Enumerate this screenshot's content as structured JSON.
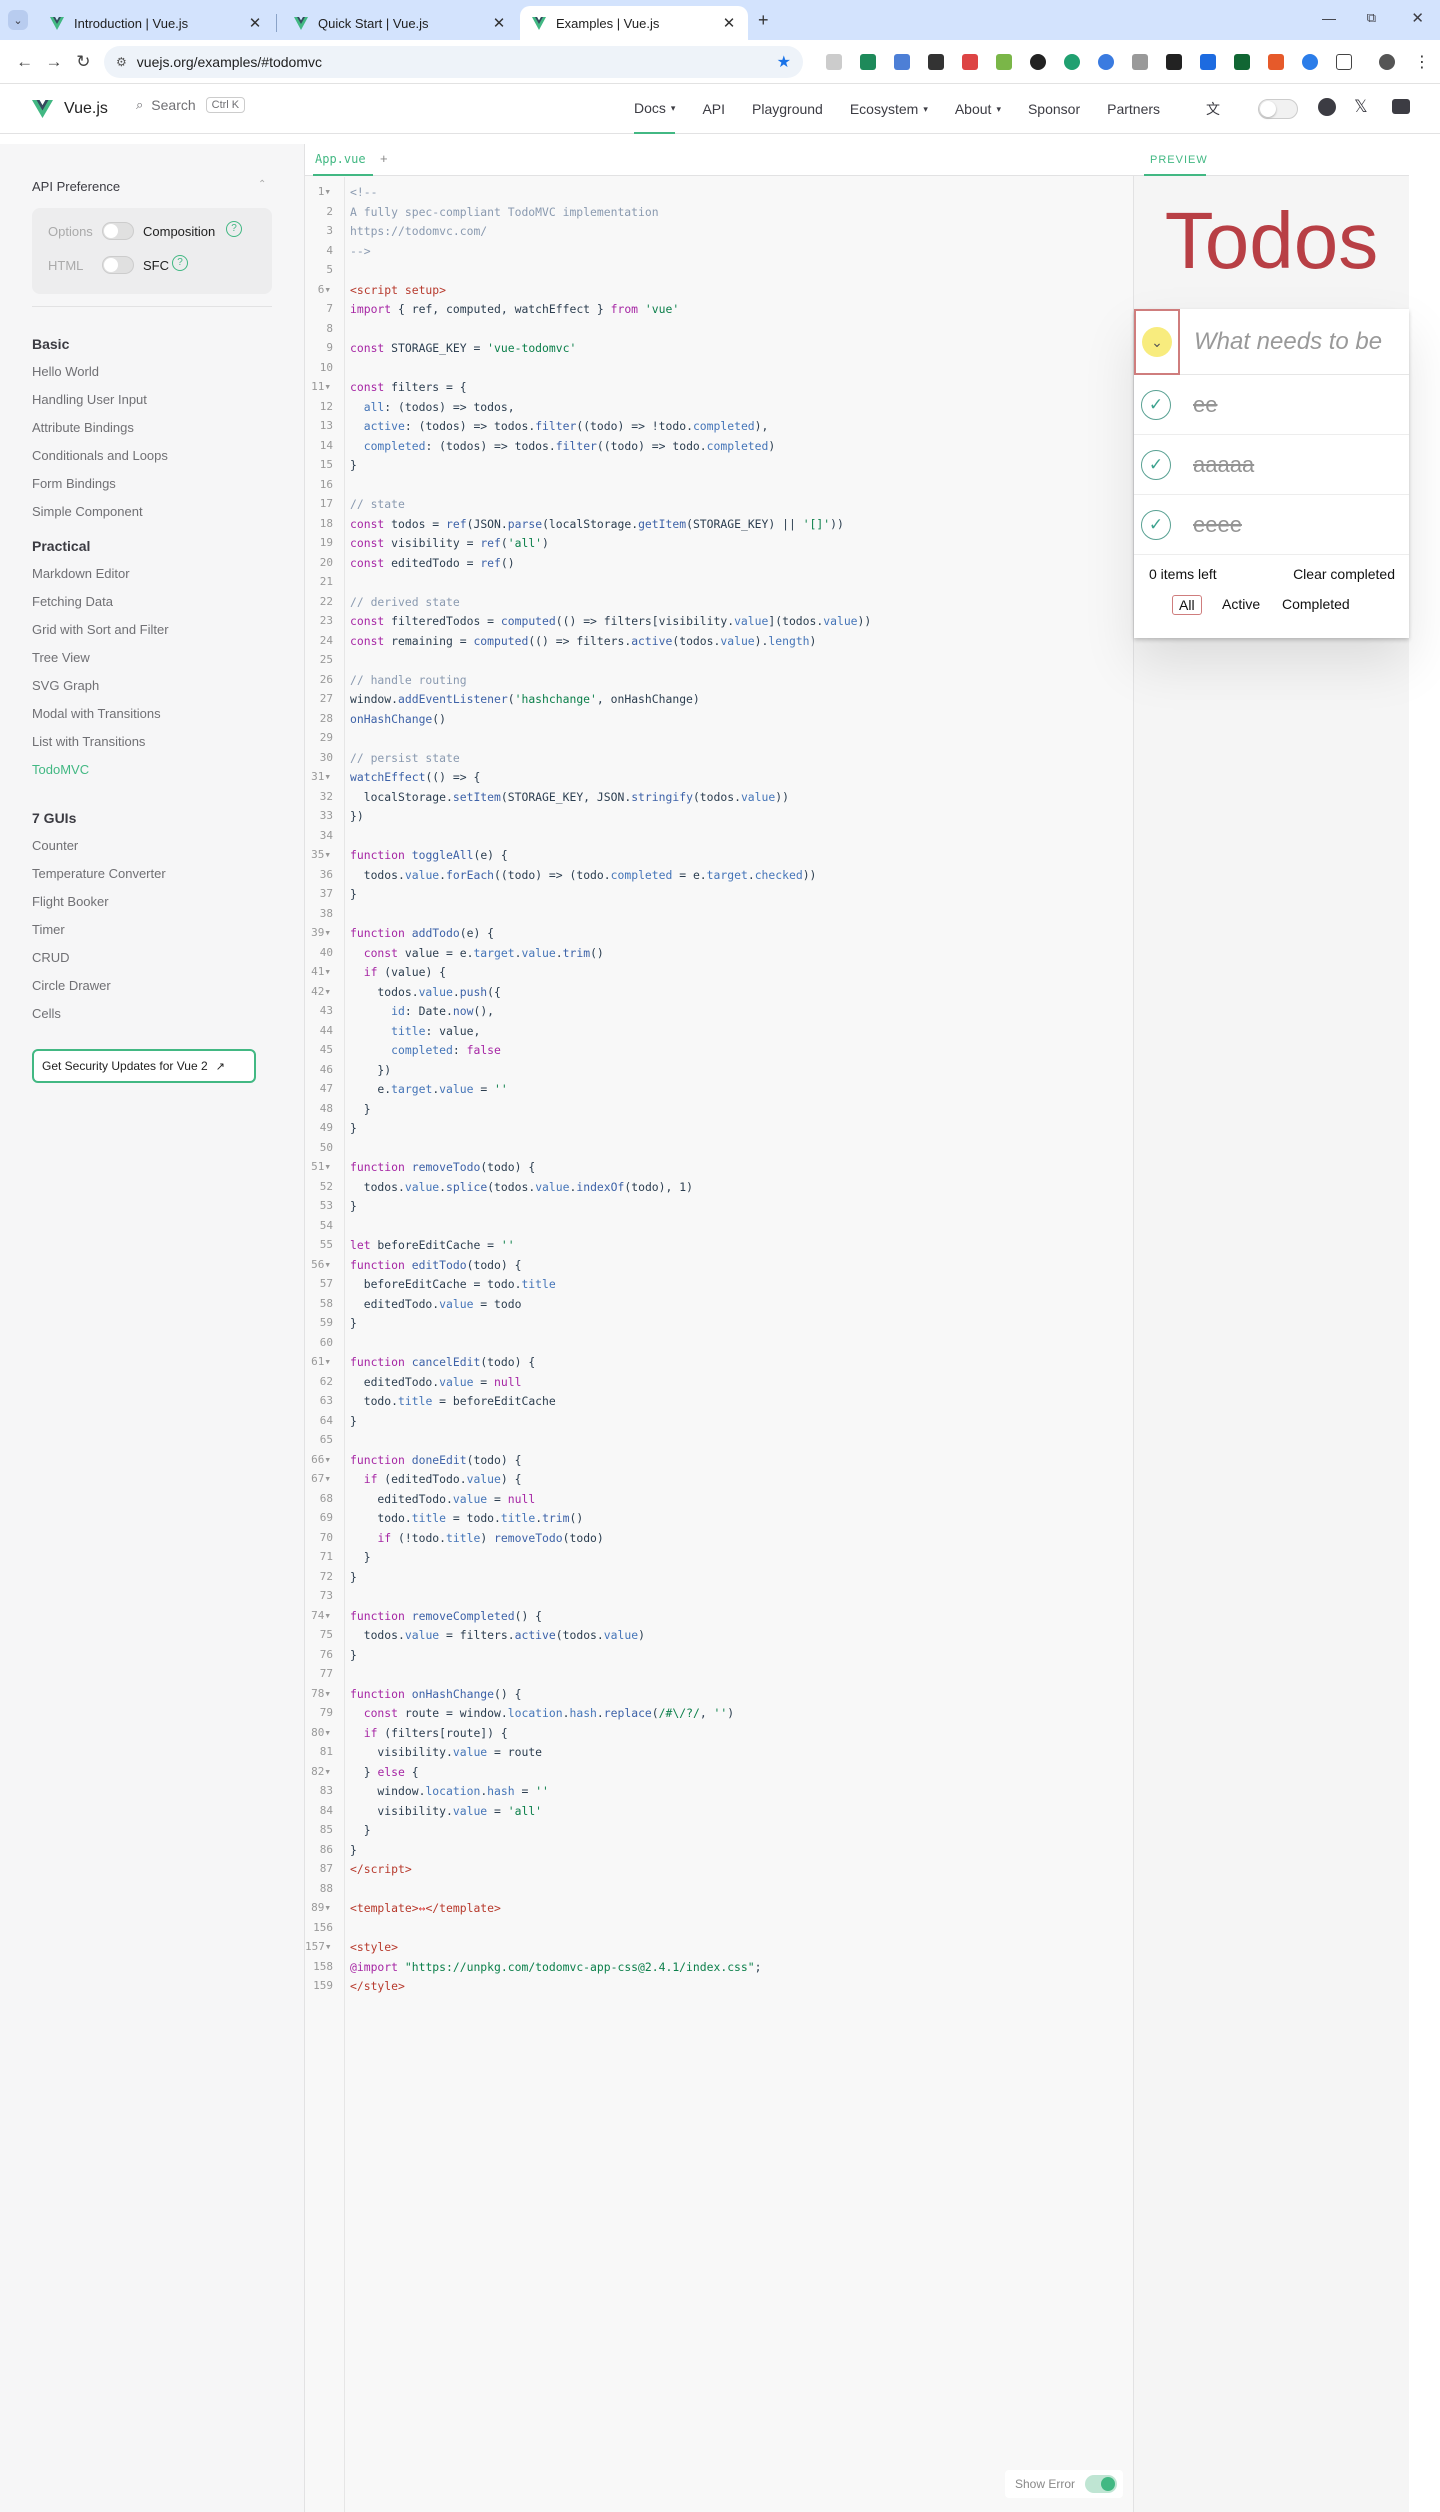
{
  "browser": {
    "tabs": [
      {
        "title": "Introduction | Vue.js"
      },
      {
        "title": "Quick Start | Vue.js"
      },
      {
        "title": "Examples | Vue.js"
      }
    ],
    "url": "vuejs.org/examples/#todomvc"
  },
  "site": {
    "logo_text": "Vue.js",
    "search_label": "Search",
    "search_shortcut": "Ctrl K",
    "nav": [
      "Docs",
      "API",
      "Playground",
      "Ecosystem",
      "About",
      "Sponsor",
      "Partners"
    ]
  },
  "sidebar": {
    "api_pref_title": "API Preference",
    "options_label": "Options",
    "composition_label": "Composition",
    "html_label": "HTML",
    "sfc_label": "SFC",
    "sections": [
      {
        "title": "Basic",
        "items": [
          "Hello World",
          "Handling User Input",
          "Attribute Bindings",
          "Conditionals and Loops",
          "Form Bindings",
          "Simple Component"
        ]
      },
      {
        "title": "Practical",
        "items": [
          "Markdown Editor",
          "Fetching Data",
          "Grid with Sort and Filter",
          "Tree View",
          "SVG Graph",
          "Modal with Transitions",
          "List with Transitions",
          "TodoMVC"
        ]
      },
      {
        "title": "7 GUIs",
        "items": [
          "Counter",
          "Temperature Converter",
          "Flight Booker",
          "Timer",
          "CRUD",
          "Circle Drawer",
          "Cells"
        ]
      }
    ],
    "security_button": "Get Security Updates for Vue 2"
  },
  "editor": {
    "file_tab": "App.vue",
    "add_tab": "+",
    "show_error_label": "Show Error"
  },
  "preview": {
    "tab_label": "PREVIEW",
    "title": "Todos",
    "input_placeholder": "What needs to be",
    "todos": [
      "ee",
      "aaaaa",
      "eeee"
    ],
    "items_left": "0 items left",
    "clear_completed": "Clear completed",
    "filters": [
      "All",
      "Active",
      "Completed"
    ]
  },
  "colors": {
    "vue_green": "#42b883",
    "todo_title": "#b83f45",
    "tab_bg": "#d3e3fd"
  }
}
